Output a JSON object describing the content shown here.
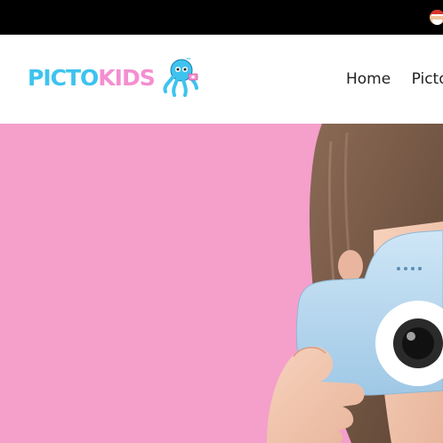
{
  "topbar": {
    "icon": "santa-face-icon",
    "background": "#000000"
  },
  "logo": {
    "part1": "PICTO",
    "part2": "KIDS",
    "trademark": "™",
    "icon": "octopus-mascot-icon",
    "colors": {
      "blue": "#3ec3ef",
      "pink": "#f48fd0"
    }
  },
  "nav": {
    "items": [
      {
        "label": "Home"
      },
      {
        "label": "PictoK"
      }
    ]
  },
  "hero": {
    "background": "#f59fcb",
    "image": "child-holding-blue-camera-photo"
  }
}
